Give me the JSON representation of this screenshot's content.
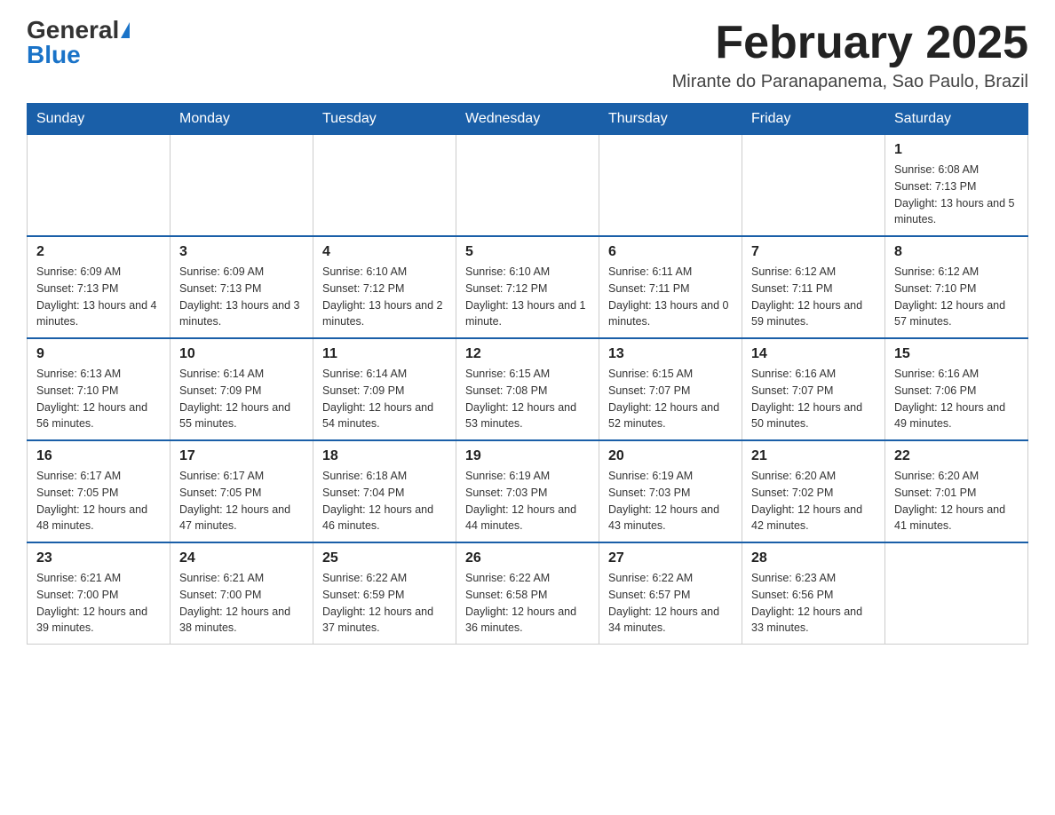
{
  "header": {
    "logo_general": "General",
    "logo_blue": "Blue",
    "calendar_title": "February 2025",
    "calendar_subtitle": "Mirante do Paranapanema, Sao Paulo, Brazil"
  },
  "days_of_week": [
    "Sunday",
    "Monday",
    "Tuesday",
    "Wednesday",
    "Thursday",
    "Friday",
    "Saturday"
  ],
  "weeks": [
    [
      {
        "day": "",
        "info": ""
      },
      {
        "day": "",
        "info": ""
      },
      {
        "day": "",
        "info": ""
      },
      {
        "day": "",
        "info": ""
      },
      {
        "day": "",
        "info": ""
      },
      {
        "day": "",
        "info": ""
      },
      {
        "day": "1",
        "info": "Sunrise: 6:08 AM\nSunset: 7:13 PM\nDaylight: 13 hours and 5 minutes."
      }
    ],
    [
      {
        "day": "2",
        "info": "Sunrise: 6:09 AM\nSunset: 7:13 PM\nDaylight: 13 hours and 4 minutes."
      },
      {
        "day": "3",
        "info": "Sunrise: 6:09 AM\nSunset: 7:13 PM\nDaylight: 13 hours and 3 minutes."
      },
      {
        "day": "4",
        "info": "Sunrise: 6:10 AM\nSunset: 7:12 PM\nDaylight: 13 hours and 2 minutes."
      },
      {
        "day": "5",
        "info": "Sunrise: 6:10 AM\nSunset: 7:12 PM\nDaylight: 13 hours and 1 minute."
      },
      {
        "day": "6",
        "info": "Sunrise: 6:11 AM\nSunset: 7:11 PM\nDaylight: 13 hours and 0 minutes."
      },
      {
        "day": "7",
        "info": "Sunrise: 6:12 AM\nSunset: 7:11 PM\nDaylight: 12 hours and 59 minutes."
      },
      {
        "day": "8",
        "info": "Sunrise: 6:12 AM\nSunset: 7:10 PM\nDaylight: 12 hours and 57 minutes."
      }
    ],
    [
      {
        "day": "9",
        "info": "Sunrise: 6:13 AM\nSunset: 7:10 PM\nDaylight: 12 hours and 56 minutes."
      },
      {
        "day": "10",
        "info": "Sunrise: 6:14 AM\nSunset: 7:09 PM\nDaylight: 12 hours and 55 minutes."
      },
      {
        "day": "11",
        "info": "Sunrise: 6:14 AM\nSunset: 7:09 PM\nDaylight: 12 hours and 54 minutes."
      },
      {
        "day": "12",
        "info": "Sunrise: 6:15 AM\nSunset: 7:08 PM\nDaylight: 12 hours and 53 minutes."
      },
      {
        "day": "13",
        "info": "Sunrise: 6:15 AM\nSunset: 7:07 PM\nDaylight: 12 hours and 52 minutes."
      },
      {
        "day": "14",
        "info": "Sunrise: 6:16 AM\nSunset: 7:07 PM\nDaylight: 12 hours and 50 minutes."
      },
      {
        "day": "15",
        "info": "Sunrise: 6:16 AM\nSunset: 7:06 PM\nDaylight: 12 hours and 49 minutes."
      }
    ],
    [
      {
        "day": "16",
        "info": "Sunrise: 6:17 AM\nSunset: 7:05 PM\nDaylight: 12 hours and 48 minutes."
      },
      {
        "day": "17",
        "info": "Sunrise: 6:17 AM\nSunset: 7:05 PM\nDaylight: 12 hours and 47 minutes."
      },
      {
        "day": "18",
        "info": "Sunrise: 6:18 AM\nSunset: 7:04 PM\nDaylight: 12 hours and 46 minutes."
      },
      {
        "day": "19",
        "info": "Sunrise: 6:19 AM\nSunset: 7:03 PM\nDaylight: 12 hours and 44 minutes."
      },
      {
        "day": "20",
        "info": "Sunrise: 6:19 AM\nSunset: 7:03 PM\nDaylight: 12 hours and 43 minutes."
      },
      {
        "day": "21",
        "info": "Sunrise: 6:20 AM\nSunset: 7:02 PM\nDaylight: 12 hours and 42 minutes."
      },
      {
        "day": "22",
        "info": "Sunrise: 6:20 AM\nSunset: 7:01 PM\nDaylight: 12 hours and 41 minutes."
      }
    ],
    [
      {
        "day": "23",
        "info": "Sunrise: 6:21 AM\nSunset: 7:00 PM\nDaylight: 12 hours and 39 minutes."
      },
      {
        "day": "24",
        "info": "Sunrise: 6:21 AM\nSunset: 7:00 PM\nDaylight: 12 hours and 38 minutes."
      },
      {
        "day": "25",
        "info": "Sunrise: 6:22 AM\nSunset: 6:59 PM\nDaylight: 12 hours and 37 minutes."
      },
      {
        "day": "26",
        "info": "Sunrise: 6:22 AM\nSunset: 6:58 PM\nDaylight: 12 hours and 36 minutes."
      },
      {
        "day": "27",
        "info": "Sunrise: 6:22 AM\nSunset: 6:57 PM\nDaylight: 12 hours and 34 minutes."
      },
      {
        "day": "28",
        "info": "Sunrise: 6:23 AM\nSunset: 6:56 PM\nDaylight: 12 hours and 33 minutes."
      },
      {
        "day": "",
        "info": ""
      }
    ]
  ]
}
